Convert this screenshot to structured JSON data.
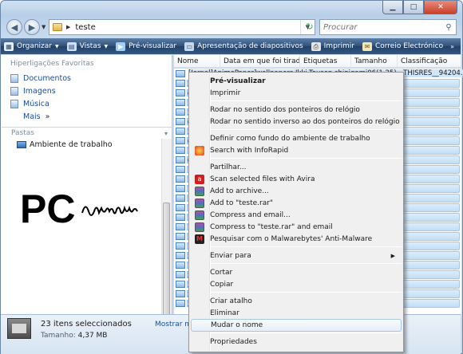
{
  "window": {
    "title": "teste"
  },
  "address": {
    "breadcrumb": "teste",
    "search_placeholder": "Procurar"
  },
  "toolbar": {
    "items": [
      {
        "label": "Organizar",
        "icon": "organize-icon",
        "has_dropdown": true
      },
      {
        "label": "Vistas",
        "icon": "views-icon",
        "has_dropdown": true
      },
      {
        "label": "Pré-visualizar",
        "icon": "preview-icon",
        "has_dropdown": false
      },
      {
        "label": "Apresentação de diapositivos",
        "icon": "slideshow-icon",
        "has_dropdown": false
      },
      {
        "label": "Imprimir",
        "icon": "print-icon",
        "has_dropdown": false
      },
      {
        "label": "Correio Electrónico",
        "icon": "email-icon",
        "has_dropdown": false
      }
    ],
    "more": "»"
  },
  "nav": {
    "favorites_header": "Hiperligações Favoritas",
    "favorites": [
      {
        "label": "Documentos",
        "icon": "documents-icon"
      },
      {
        "label": "Imagens",
        "icon": "pictures-icon"
      },
      {
        "label": "Música",
        "icon": "music-icon"
      }
    ],
    "more_label": "Mais",
    "more_chevron": "»",
    "folders_header": "Pastas",
    "folders_chevron": "▾",
    "tree_item": "Ambiente de trabalho"
  },
  "columns": [
    "Nome",
    "Data em que foi tirada",
    "Etiquetas",
    "Tamanho",
    "Classificação"
  ],
  "files": {
    "top_row_text": "[Jarpal]AnimePaper]wallpapers Ikki-Tousen shinigami06(1.25)__THISRES__94204.jpg",
    "row_prefixes": [
      "2",
      "0",
      "1",
      "2",
      "0",
      "2",
      "0",
      "1",
      "0",
      "1",
      "1",
      "1",
      "1",
      "1",
      "1",
      "1",
      "1",
      "1",
      "2",
      "1",
      "2",
      "2",
      "2",
      "2"
    ]
  },
  "logo": {
    "text": "PC",
    "script": "mania"
  },
  "status": {
    "selected": "23 itens seleccionados",
    "size_label": "Tamanho:",
    "size_value": "4,37 MB",
    "more_details": "Mostrar mai"
  },
  "context_menu": {
    "items": [
      {
        "label": "Pré-visualizar",
        "bold": true,
        "icon": ""
      },
      {
        "label": "Imprimir",
        "icon": ""
      },
      {
        "sep": true
      },
      {
        "label": "Rodar no sentido dos ponteiros do relógio",
        "icon": ""
      },
      {
        "label": "Rodar no sentido inverso ao dos ponteiros do relógio",
        "icon": ""
      },
      {
        "sep": true
      },
      {
        "label": "Definir como fundo do ambiente de trabalho",
        "icon": ""
      },
      {
        "label": "Search with InfoRapid",
        "icon": "inforapid-icon"
      },
      {
        "sep": true
      },
      {
        "label": "Partilhar...",
        "icon": ""
      },
      {
        "label": "Scan selected files with Avira",
        "icon": "avira-icon"
      },
      {
        "label": "Add to archive...",
        "icon": "winrar-icon"
      },
      {
        "label": "Add to \"teste.rar\"",
        "icon": "winrar-icon"
      },
      {
        "label": "Compress and email...",
        "icon": "winrar-icon"
      },
      {
        "label": "Compress to \"teste.rar\" and email",
        "icon": "winrar-icon"
      },
      {
        "label": "Pesquisar com o Malwarebytes' Anti-Malware",
        "icon": "malwarebytes-icon"
      },
      {
        "sep": true
      },
      {
        "label": "Enviar para",
        "icon": "",
        "submenu": true
      },
      {
        "sep": true
      },
      {
        "label": "Cortar",
        "icon": ""
      },
      {
        "label": "Copiar",
        "icon": ""
      },
      {
        "sep": true
      },
      {
        "label": "Criar atalho",
        "icon": ""
      },
      {
        "label": "Eliminar",
        "icon": ""
      },
      {
        "label": "Mudar o nome",
        "icon": "",
        "highlighted": true
      },
      {
        "sep": true
      },
      {
        "label": "Propriedades",
        "icon": ""
      }
    ],
    "submenu_arrow": "▶"
  }
}
